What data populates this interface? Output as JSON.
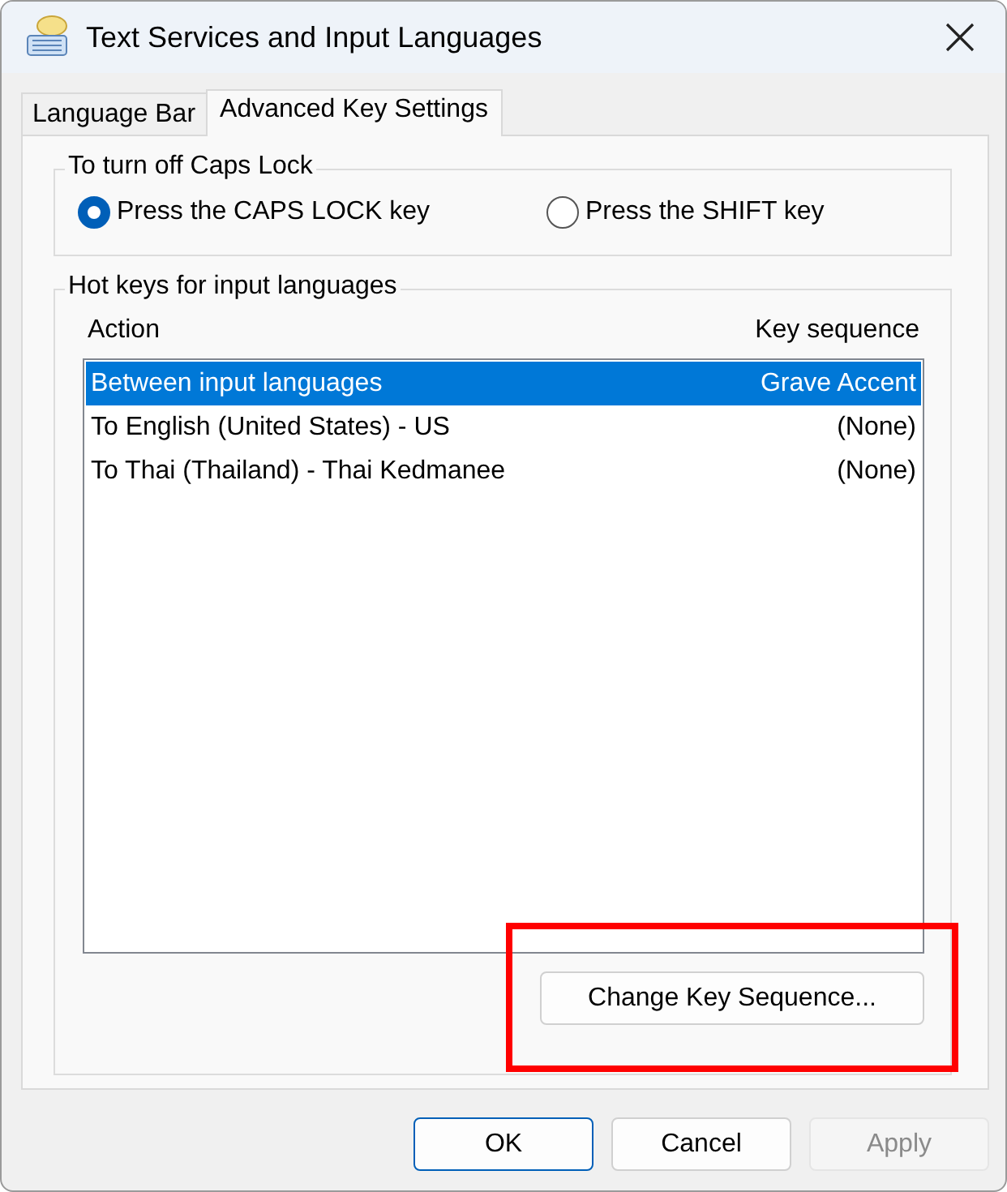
{
  "window": {
    "title": "Text Services and Input Languages"
  },
  "tabs": [
    {
      "label": "Language Bar",
      "selected": false
    },
    {
      "label": "Advanced Key Settings",
      "selected": true
    }
  ],
  "caps_lock_group": {
    "title": "To turn off Caps Lock",
    "options": [
      {
        "label": "Press the CAPS LOCK key",
        "selected": true
      },
      {
        "label": "Press the SHIFT key",
        "selected": false
      }
    ]
  },
  "hot_keys_group": {
    "title": "Hot keys for input languages",
    "columns": [
      "Action",
      "Key sequence"
    ],
    "rows": [
      {
        "action": "Between input languages",
        "key_sequence": "Grave Accent",
        "selected": true
      },
      {
        "action": "To English (United States) - US",
        "key_sequence": "(None)",
        "selected": false
      },
      {
        "action": "To Thai (Thailand) - Thai Kedmanee",
        "key_sequence": "(None)",
        "selected": false
      }
    ],
    "change_button": {
      "label": "Change Key Sequence...",
      "highlighted": true
    }
  },
  "buttons": [
    {
      "label": "OK",
      "default": true,
      "disabled": false
    },
    {
      "label": "Cancel",
      "default": false,
      "disabled": false
    },
    {
      "label": "Apply",
      "default": false,
      "disabled": true
    }
  ]
}
